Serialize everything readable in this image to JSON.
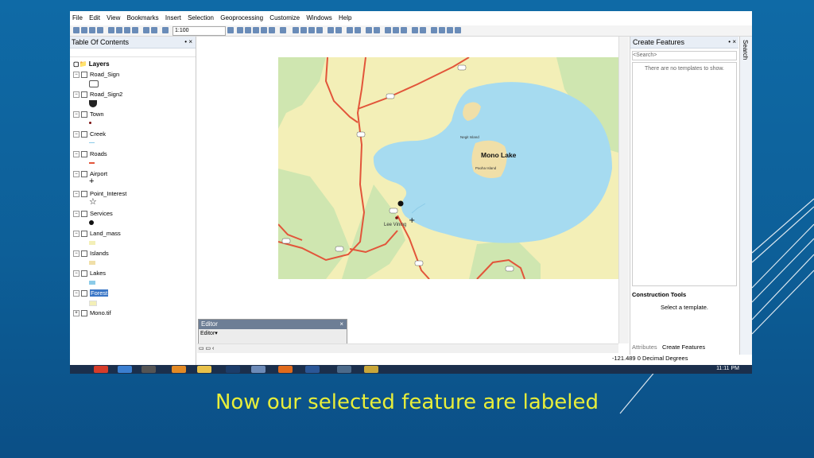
{
  "caption": "Now our selected feature are labeled",
  "menu": [
    "File",
    "Edit",
    "View",
    "Bookmarks",
    "Insert",
    "Selection",
    "Geoprocessing",
    "Customize",
    "Windows",
    "Help"
  ],
  "toolbar": {
    "scale": "1:100"
  },
  "toc": {
    "title": "Table Of Contents",
    "root": "Layers",
    "layers": [
      "Road_Sign",
      "Road_Sign2",
      "Town",
      "Creek",
      "Roads",
      "Airport",
      "Point_Interest",
      "Services",
      "Land_mass",
      "Islands",
      "Lakes",
      "Forest",
      "Mono.tif"
    ]
  },
  "map": {
    "lake_label": "Mono Lake",
    "island1": "Negit Island",
    "island2": "Paoha Island",
    "town": "Lee Vining"
  },
  "editor": {
    "title": "Editor",
    "menu": "Editor"
  },
  "create_features": {
    "title": "Create Features",
    "search_placeholder": "<Search>",
    "empty_msg": "There are no templates to show.",
    "construction_tools": "Construction Tools",
    "select_template": "Select a template.",
    "tab_attributes": "Attributes",
    "tab_create": "Create Features"
  },
  "search_tab": "Search",
  "status": {
    "coords": "-121.489  0 Decimal Degrees"
  },
  "taskbar": {
    "time": "11:11 PM"
  },
  "colors": {
    "lake": "#a6dbf0",
    "land": "#f3efb7",
    "forest": "#cfe6b0",
    "road": "#e2553a",
    "caption": "#e8ee3a"
  }
}
